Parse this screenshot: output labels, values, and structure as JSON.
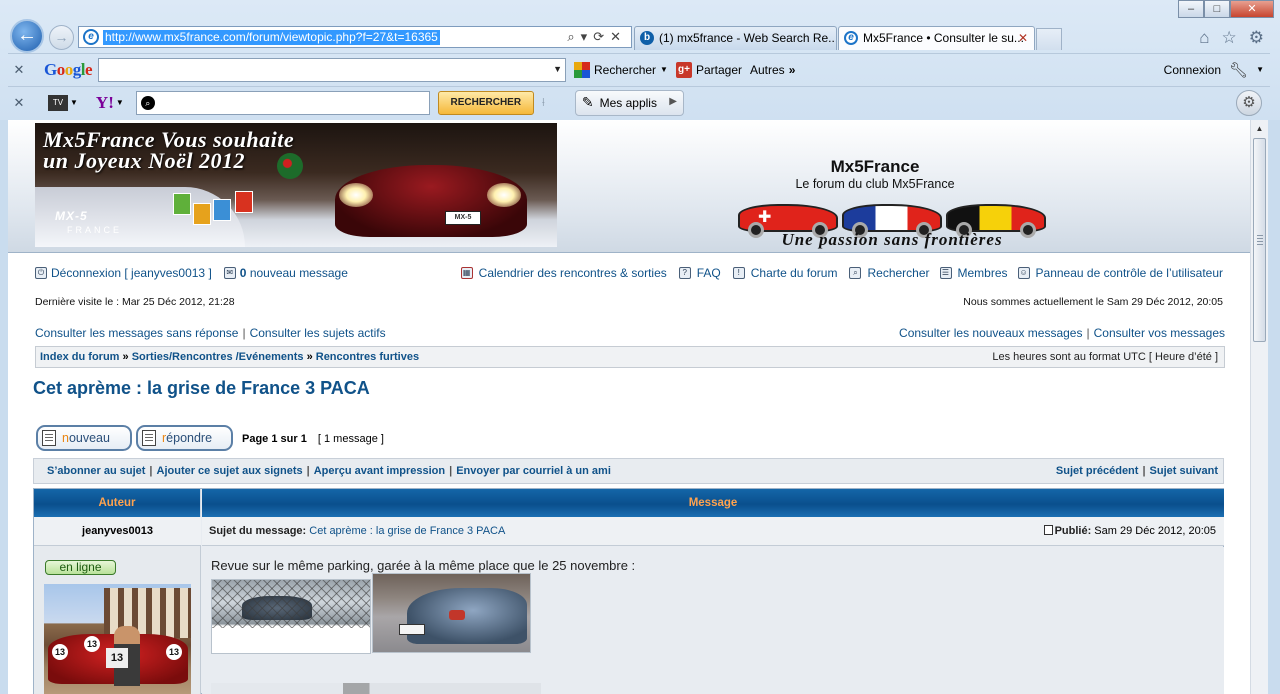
{
  "browser": {
    "address_url": "http://www.mx5france.com/forum/viewtopic.php?f=27&t=16365",
    "tabs": [
      {
        "label": "(1) mx5france - Web Search Re...",
        "icon": "bing-icon"
      },
      {
        "label": "Mx5France • Consulter le su...",
        "icon": "ie-icon"
      }
    ],
    "win_controls": [
      "minimize",
      "maximize",
      "close"
    ],
    "google_toolbar": {
      "logo": "Google",
      "search_label": "Rechercher",
      "share_label": "Partager",
      "more_label": "Autres",
      "more_glyph": "»",
      "login_label": "Connexion"
    },
    "yahoo_toolbar": {
      "logo": "Y!",
      "tv_label": "TV",
      "search_button": "RECHERCHER",
      "apps_label": "Mes applis"
    }
  },
  "site": {
    "banner_text_line1": "Mx5France Vous souhaite",
    "banner_text_line2": "un Joyeux Noël 2012",
    "banner_logo": "MX-5",
    "banner_logo_sub": "FRANCE",
    "title": "Mx5France",
    "subtitle": "Le forum du club Mx5France",
    "slogan": "Une passion sans frontières"
  },
  "nav": {
    "logout": "Déconnexion [ jeanyves0013 ]",
    "new_messages_count": "0",
    "new_messages_label": "nouveau message",
    "calendar": "Calendrier des rencontres & sorties",
    "faq": "FAQ",
    "charter": "Charte du forum",
    "search": "Rechercher",
    "members": "Membres",
    "ucp": "Panneau de contrôle de l’utilisateur",
    "last_visit": "Dernière visite le : Mar 25 Déc 2012, 21:28",
    "current_time": "Nous sommes actuellement le Sam 29 Déc 2012, 20:05",
    "unanswered": "Consulter les messages sans réponse",
    "active": "Consulter les sujets actifs",
    "new_posts": "Consulter les nouveaux messages",
    "your_posts": "Consulter vos messages"
  },
  "breadcrumbs": {
    "items": [
      "Index du forum",
      "Sorties/Rencontres /Evénements",
      "Rencontres furtives"
    ],
    "separator": "»",
    "timezone": "Les heures sont au format UTC [ Heure d’été ]"
  },
  "topic": {
    "title": "Cet aprème : la grise de France 3 PACA",
    "new_button_first": "n",
    "new_button_rest": "ouveau",
    "reply_button_first": "r",
    "reply_button_rest": "épondre",
    "page_info": "Page 1 sur 1",
    "message_count": "[ 1 message ]",
    "actions": [
      "S’abonner au sujet",
      "Ajouter ce sujet aux signets",
      "Aperçu avant impression",
      "Envoyer par courriel à un ami"
    ],
    "prev_topic": "Sujet précédent",
    "next_topic": "Sujet suivant"
  },
  "post": {
    "header_author": "Auteur",
    "header_message": "Message",
    "author": "jeanyves0013",
    "online_label": "en ligne",
    "subject_label": "Sujet du message:",
    "subject": "Cet aprème : la grise de France 3 PACA",
    "posted_label": "Publié:",
    "posted_date": "Sam 29 Déc 2012, 20:05",
    "body": "Revue sur le même parking, garée à la même place que le 25 novembre :",
    "avatar_numbers": [
      "13",
      "13",
      "13"
    ]
  },
  "colors": {
    "link": "#105289",
    "table_header": "#0a4f8d",
    "table_header_text": "#ffa34f",
    "button_accent": "#e98512"
  }
}
